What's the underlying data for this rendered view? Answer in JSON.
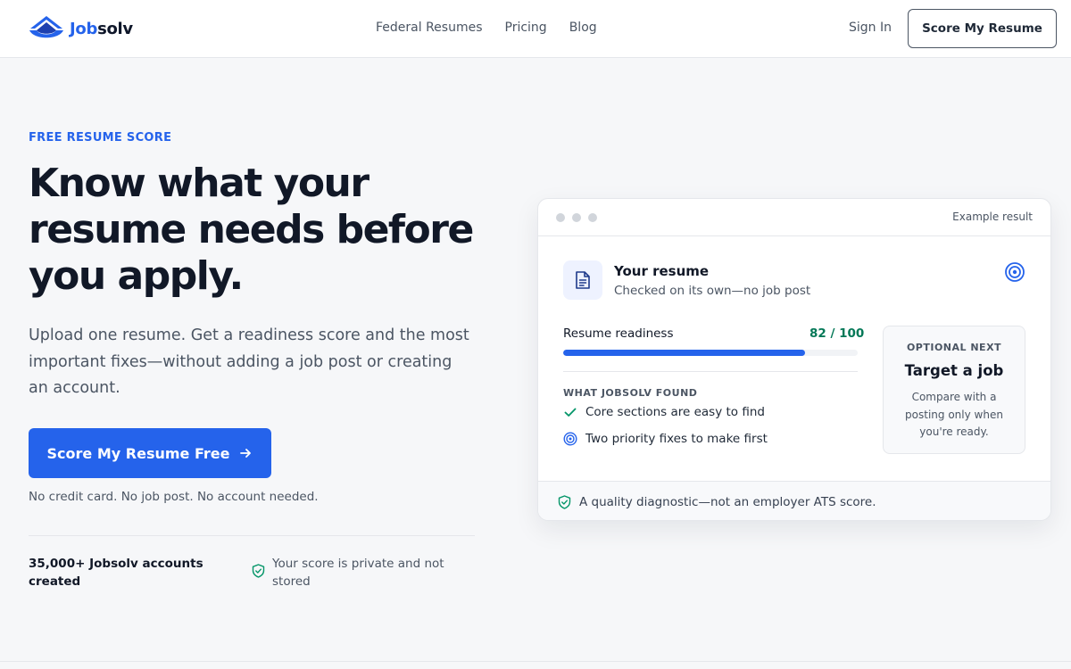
{
  "brand": {
    "name_part1": "Job",
    "name_part2": "solv",
    "logo_icon": "jobsolv-logo-icon",
    "accent_color": "#2563eb"
  },
  "nav": {
    "links": [
      "Federal Resumes",
      "Pricing",
      "Blog"
    ],
    "sign_in": "Sign In",
    "header_cta": "Score My Resume"
  },
  "hero": {
    "eyebrow": "FREE RESUME SCORE",
    "headline_lines": [
      "Know what your",
      "resume needs before",
      "you apply."
    ],
    "subtext": "Upload one resume. Get a readiness score and the most important fixes—without adding a job post or creating an account.",
    "cta": "Score My Resume Free",
    "cta_icon": "arrow-right-icon",
    "note": "No credit card. No job post. No account needed.",
    "stat": "35,000+ Jobsolv accounts created",
    "privacy_icon": "shield-check-icon",
    "privacy": "Your score is private and not stored"
  },
  "card": {
    "example_label": "Example result",
    "title": "Your resume",
    "subtitle": "Checked on its own—no job post",
    "doc_icon": "document-icon",
    "target_icon": "target-icon",
    "readiness_label": "Resume readiness",
    "score_text": "82 / 100",
    "score_value": 82,
    "score_max": 100,
    "found_label": "WHAT JOBSOLV FOUND",
    "findings": [
      {
        "icon": "check-icon",
        "text": "Core sections are easy to find"
      },
      {
        "icon": "target-icon",
        "text": "Two priority fixes to make first"
      }
    ],
    "side": {
      "eyebrow": "OPTIONAL NEXT",
      "title": "Target a job",
      "desc": "Compare with a posting only when you're ready."
    },
    "footer_icon": "shield-check-icon",
    "footer": "A quality diagnostic—not an employer ATS score.",
    "score_color": "#047857"
  }
}
